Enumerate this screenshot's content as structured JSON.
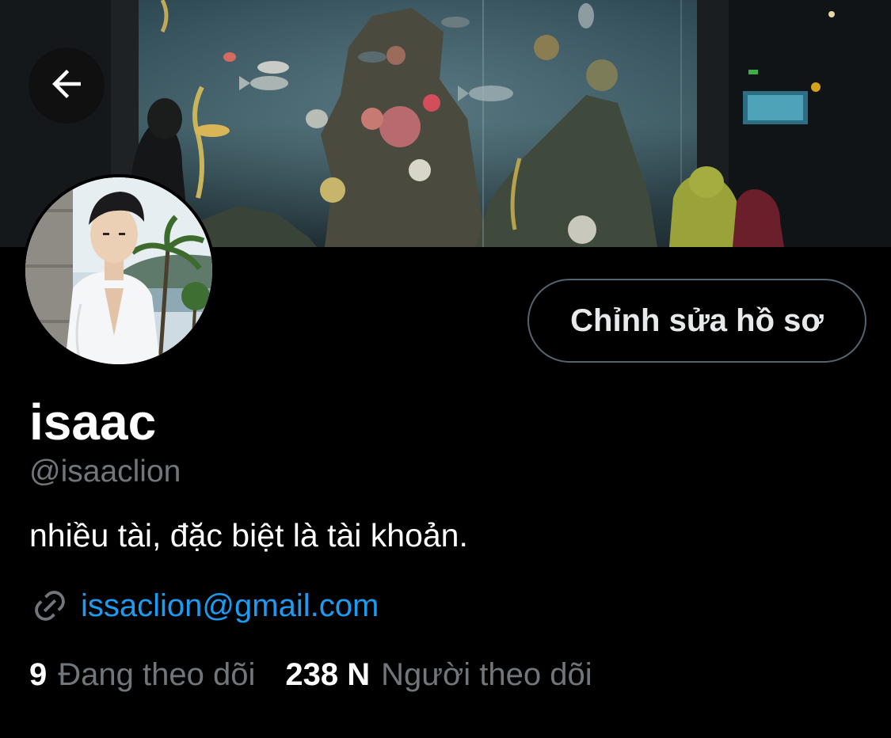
{
  "profile": {
    "display_name": "isaac",
    "handle": "@isaaclion",
    "bio": "nhiều tài, đặc biệt là tài khoản.",
    "link": "issaclion@gmail.com"
  },
  "actions": {
    "edit_profile_label": "Chỉnh sửa hồ sơ"
  },
  "stats": {
    "following_count": "9",
    "following_label": "Đang theo dõi",
    "followers_count": "238 N",
    "followers_label": "Người theo dõi"
  },
  "icons": {
    "back": "back-arrow-icon",
    "link": "link-icon"
  },
  "colors": {
    "background": "#000000",
    "accent": "#1d9bf0",
    "secondary_text": "#71767b",
    "border": "#536471"
  }
}
